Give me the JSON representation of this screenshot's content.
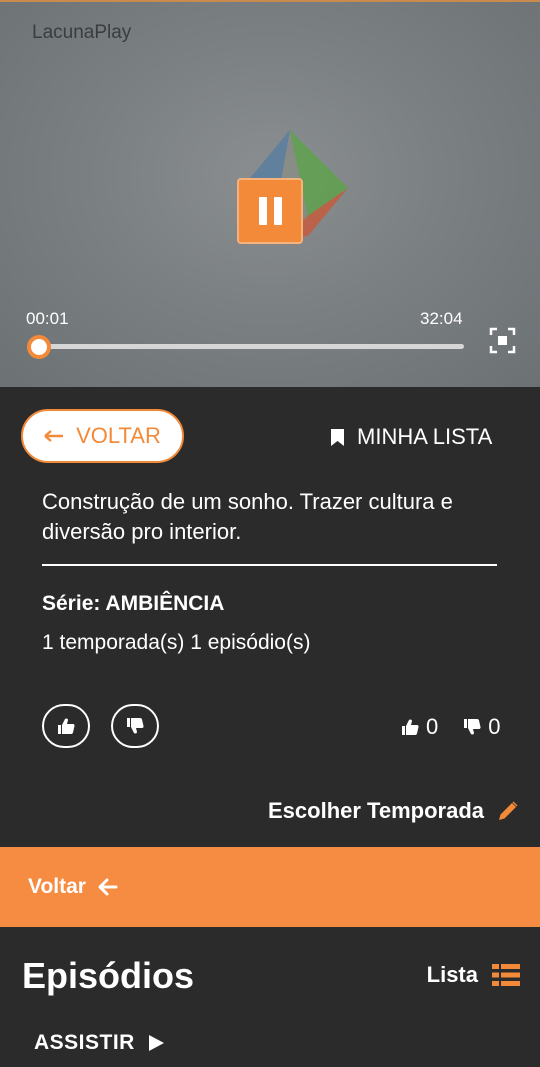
{
  "player": {
    "brand": "LacunaPlay",
    "current_time": "00:01",
    "total_time": "32:04",
    "progress_fraction": 0.0005,
    "state": "playing"
  },
  "actions": {
    "back_label": "VOLTAR",
    "my_list_label": "MINHA LISTA"
  },
  "details": {
    "description": "Construção de um sonho. Trazer cultura e diversão pro interior.",
    "series_label": "Série: AMBIÊNCIA",
    "counts": "1 temporada(s)  1 episódio(s)",
    "likes": "0",
    "dislikes": "0",
    "choose_season_label": "Escolher Temporada"
  },
  "orange_bar": {
    "label": "Voltar"
  },
  "episodes": {
    "title": "Episódios",
    "list_label": "Lista",
    "watch_label": "ASSISTIR"
  },
  "colors": {
    "accent": "#f68c41",
    "background": "#2b2b2b",
    "player_bg": "#7b8083"
  }
}
